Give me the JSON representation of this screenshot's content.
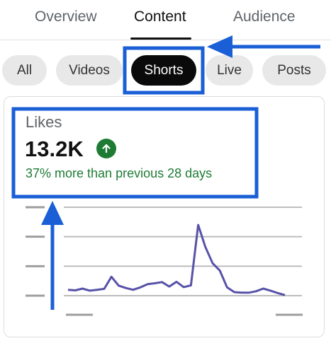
{
  "tabs": [
    {
      "label": "Overview"
    },
    {
      "label": "Content"
    },
    {
      "label": "Audience"
    }
  ],
  "active_tab": "Content",
  "chips": [
    {
      "label": "All"
    },
    {
      "label": "Videos"
    },
    {
      "label": "Shorts"
    },
    {
      "label": "Live"
    },
    {
      "label": "Posts"
    }
  ],
  "selected_chip": "Shorts",
  "metric": {
    "label": "Likes",
    "value": "13.2K",
    "trend_icon": "arrow-up-icon",
    "comparison": "37% more than previous 28 days"
  },
  "colors": {
    "annotation_blue": "#1a5fd6",
    "positive_green": "#1e7b34",
    "line_color": "#5752a8"
  },
  "chart_data": {
    "type": "line",
    "title": "",
    "xlabel": "",
    "ylabel": "",
    "tick_labels_visible": false,
    "series": [
      {
        "values": [
          2,
          1.8,
          2.4,
          1.7,
          2.0,
          2.3,
          6.4,
          3.4,
          2.6,
          2.0,
          2.8,
          3.9,
          4.2,
          4.6,
          3.1,
          4.7,
          2.9,
          3.5,
          24.0,
          16.5,
          11.0,
          8.5,
          2.8,
          1.2,
          1.0,
          1.0,
          1.5,
          2.4,
          1.7,
          0.9,
          0.2
        ],
        "color": "#5752a8"
      }
    ],
    "ylim": [
      0,
      30
    ],
    "grid": true
  }
}
